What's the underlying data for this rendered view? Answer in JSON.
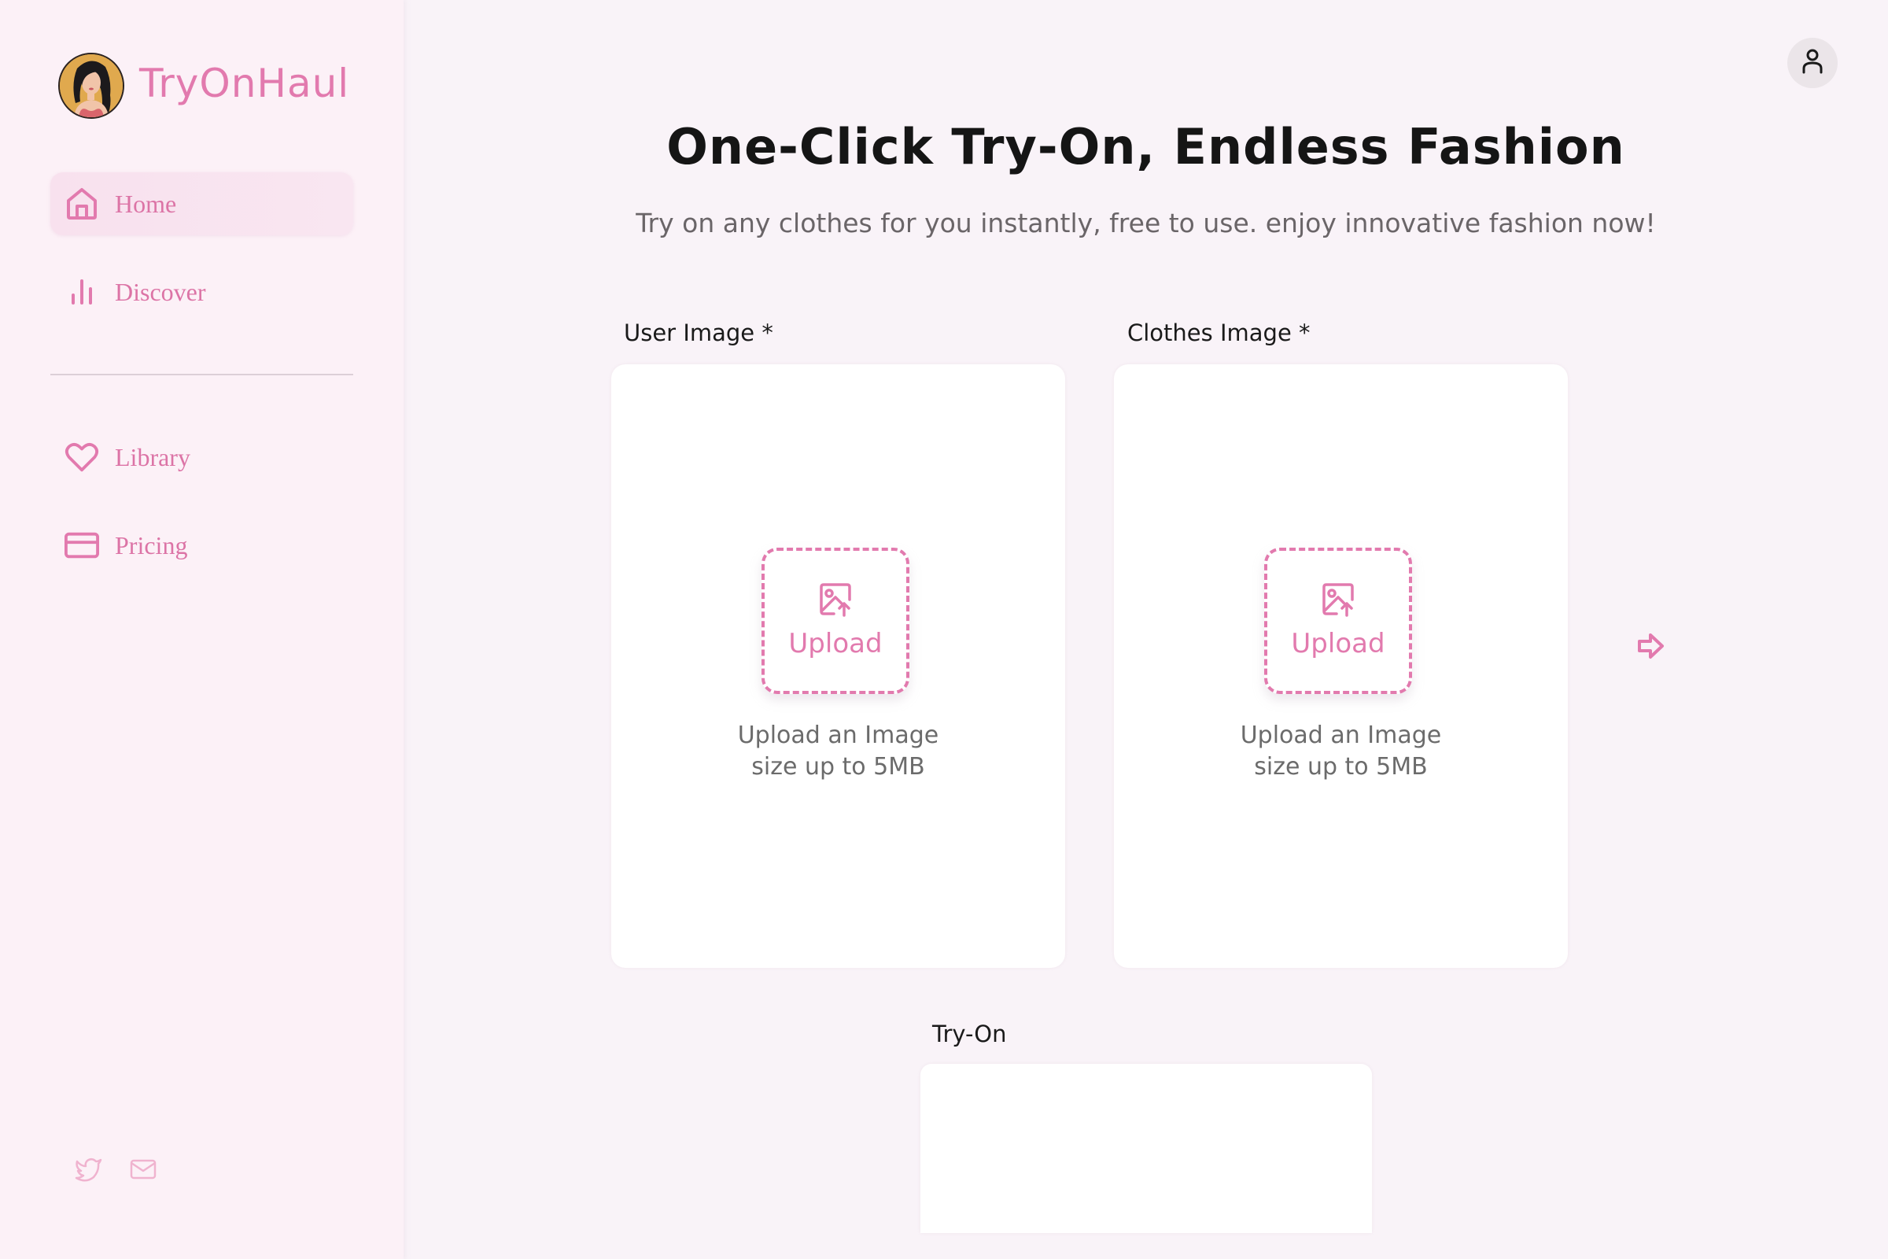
{
  "brand": {
    "name": "TryOnHaul",
    "logo_icon": "woman-avatar-logo",
    "accent_color": "#e27aae"
  },
  "sidebar": {
    "items": [
      {
        "label": "Home",
        "icon": "home-icon",
        "active": true
      },
      {
        "label": "Discover",
        "icon": "bar-chart-icon",
        "active": false
      },
      {
        "label": "Library",
        "icon": "heart-icon",
        "active": false
      },
      {
        "label": "Pricing",
        "icon": "credit-card-icon",
        "active": false
      }
    ],
    "social": [
      {
        "icon": "twitter-icon"
      },
      {
        "icon": "mail-icon"
      }
    ]
  },
  "header": {
    "profile_icon": "user-icon"
  },
  "main": {
    "title": "One-Click Try-On, Endless Fashion",
    "subtitle": "Try on any clothes for you instantly, free to use. enjoy innovative fashion now!",
    "user_image": {
      "label": "User Image *",
      "upload_label": "Upload",
      "caption_line1": "Upload an Image",
      "caption_line2": "size up to 5MB"
    },
    "clothes_image": {
      "label": "Clothes Image *",
      "upload_label": "Upload",
      "caption_line1": "Upload an Image",
      "caption_line2": "size up to 5MB"
    },
    "next_icon": "arrow-right-icon",
    "try_on": {
      "label": "Try-On"
    }
  }
}
